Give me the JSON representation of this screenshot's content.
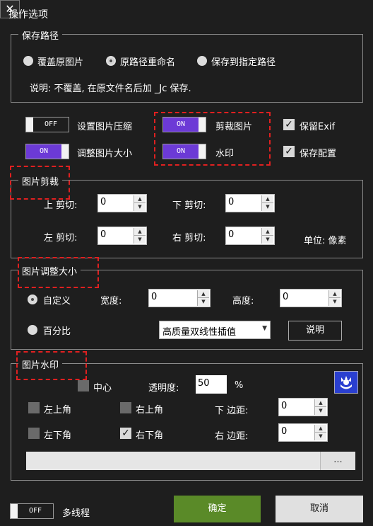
{
  "window": {
    "title": "操作选项",
    "close_glyph": "✕"
  },
  "save_path": {
    "legend": "保存路径",
    "options": [
      "覆盖原图片",
      "原路径重命名",
      "保存到指定路径"
    ],
    "selected_index": 1,
    "description": "说明: 不覆盖, 在原文件名后加 _Jc 保存."
  },
  "toggles": {
    "compress": {
      "state": "OFF",
      "label": "设置图片压缩"
    },
    "crop": {
      "state": "ON",
      "label": "剪裁图片"
    },
    "resize": {
      "state": "ON",
      "label": "调整图片大小"
    },
    "watermark": {
      "state": "ON",
      "label": "水印"
    }
  },
  "checks": {
    "keep_exif": {
      "checked": true,
      "label": "保留Exif"
    },
    "save_config": {
      "checked": true,
      "label": "保存配置"
    }
  },
  "crop": {
    "legend": "图片剪裁",
    "top_label": "上 剪切:",
    "top_value": "0",
    "bottom_label": "下 剪切:",
    "bottom_value": "0",
    "left_label": "左 剪切:",
    "left_value": "0",
    "right_label": "右 剪切:",
    "right_value": "0",
    "unit": "单位: 像素"
  },
  "resize": {
    "legend": "图片调整大小",
    "custom_label": "自定义",
    "percent_label": "百分比",
    "width_label": "宽度:",
    "width_value": "0",
    "height_label": "高度:",
    "height_value": "0",
    "interp_value": "高质量双线性插值",
    "explain_label": "说明"
  },
  "watermark": {
    "legend": "图片水印",
    "center_label": "中心",
    "opacity_label": "透明度:",
    "opacity_value": "50",
    "opacity_unit": "%",
    "top_left_label": "左上角",
    "top_right_label": "右上角",
    "bottom_left_label": "左下角",
    "bottom_right_label": "右下角",
    "bottom_margin_label": "下 边距:",
    "bottom_margin_value": "0",
    "right_margin_label": "右 边距:",
    "right_margin_value": "0",
    "path_value": "",
    "browse_label": "..."
  },
  "footer": {
    "multithread_state": "OFF",
    "multithread_label": "多线程",
    "ok_label": "确定",
    "cancel_label": "取消"
  },
  "colors": {
    "background": "#1e1e1e",
    "toggle_on": "#6c3ad6",
    "ok_button": "#5a8a28",
    "annotation_dash": "#e02020",
    "icon_blue": "#2a3fd0"
  }
}
